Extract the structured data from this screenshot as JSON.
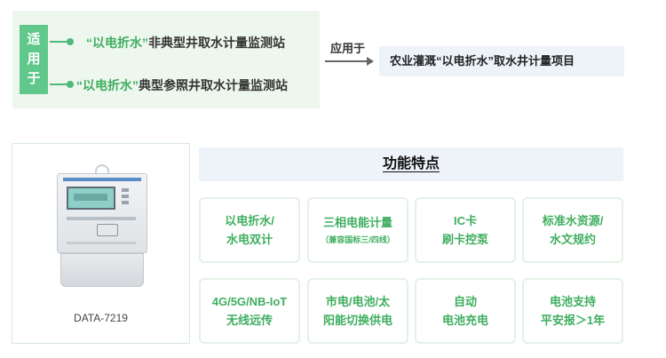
{
  "applicable": {
    "tag": [
      "适",
      "用",
      "于"
    ],
    "items": [
      {
        "highlight": "“以电折水”",
        "rest": "非典型井取水计量监测站"
      },
      {
        "highlight": "“以电折水”",
        "rest": "典型参照井取水计量监测站"
      }
    ]
  },
  "applied_to": {
    "label": "应用于",
    "target": "农业灌溉“以电折水”取水井计量项目"
  },
  "product": {
    "model": "DATA-7219"
  },
  "features": {
    "title": "功能特点",
    "items": [
      {
        "line1": "以电折水/",
        "line2": "水电双计",
        "sub": ""
      },
      {
        "line1": "三相电能计量",
        "line2": "",
        "sub": "（兼容国标三/四线）"
      },
      {
        "line1": "IC卡",
        "line2": "刷卡控泵",
        "sub": ""
      },
      {
        "line1": "标准水资源/",
        "line2": "水文规约",
        "sub": ""
      },
      {
        "line1": "4G/5G/NB-IoT",
        "line2": "无线远传",
        "sub": ""
      },
      {
        "line1": "市电/电池/太",
        "line2": "阳能切换供电",
        "sub": ""
      },
      {
        "line1": "自动",
        "line2": "电池充电",
        "sub": ""
      },
      {
        "line1": "电池支持",
        "line2": "平安报＞1年",
        "sub": ""
      }
    ]
  },
  "colors": {
    "accent_green": "#3fae5f",
    "tag_green": "#5fc88a",
    "panel_bg": "#eef7ee",
    "title_bg": "#eef2f9"
  }
}
